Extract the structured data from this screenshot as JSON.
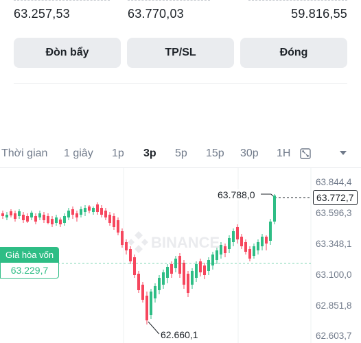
{
  "prices": {
    "left": "63.257,53",
    "middle": "63.770,03",
    "right": "59.816,55"
  },
  "buttons": {
    "leverage": "Đòn bẩy",
    "tpsl": "TP/SL",
    "close": "Đóng"
  },
  "timeframes": {
    "label": "Thời gian",
    "items": [
      "1 giây",
      "1p",
      "3p",
      "5p",
      "15p",
      "30p",
      "1H"
    ],
    "active": "3p",
    "icons": [
      "expand-icon",
      "chevron-down-icon"
    ]
  },
  "chart": {
    "watermark": "BINANCE",
    "y_ticks": [
      "63.844,4",
      "63.596,3",
      "63.348,1",
      "63.100,0",
      "62.851,8",
      "62.603,7"
    ],
    "current_price": "63.772,7",
    "high_label": "63.788,0",
    "low_label": "62.660,1",
    "break_even_title": "Giá hòa vốn",
    "break_even_value": "63.229,7",
    "colors": {
      "up": "#2ebd85",
      "down": "#f6465d",
      "break_even": "#2ebd85"
    }
  }
}
